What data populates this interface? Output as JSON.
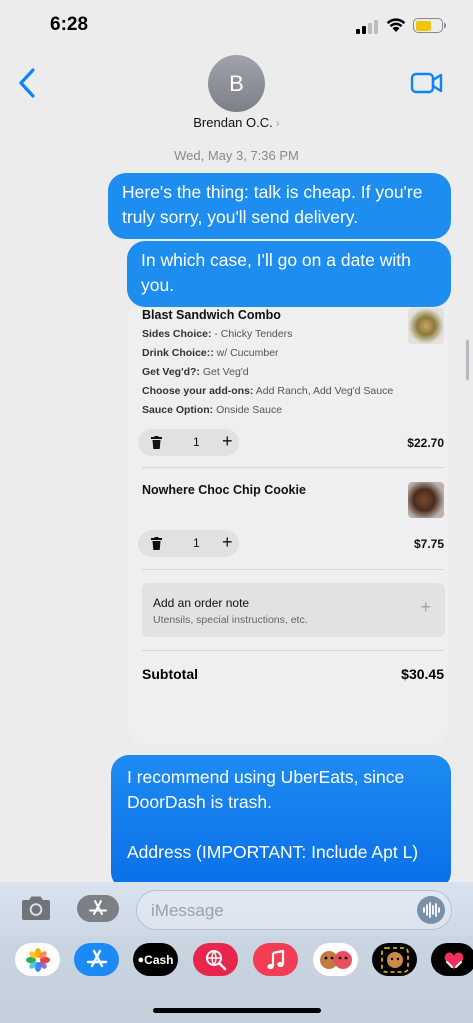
{
  "status_bar": {
    "time": "6:28"
  },
  "header": {
    "avatar_initial": "B",
    "contact_name": "Brendan O.C.",
    "contact_chevron": "›",
    "back_icon": "chevron-left-icon",
    "video_icon": "video-camera-icon",
    "accent_color": "#0a84ff"
  },
  "thread": {
    "timestamp": "Wed, May 3, 7:36 PM",
    "messages": [
      {
        "text": "Here's the thing: talk is cheap. If you're truly sorry, you'll send delivery."
      },
      {
        "text": "In which case, I'll go on a date with you."
      },
      {
        "text": "I recommend using UberEats, since DoorDash is trash.\n\nAddress (IMPORTANT: Include Apt L)"
      }
    ],
    "bubble_color": "#1e8df0"
  },
  "order": {
    "items": [
      {
        "name": "Blast Sandwich Combo",
        "options": [
          {
            "label": "Sides Choice:",
            "value": " - Chicky Tenders"
          },
          {
            "label": "Drink Choice::",
            "value": " w/ Cucumber"
          },
          {
            "label": "Get Veg'd?:",
            "value": " Get Veg'd"
          },
          {
            "label": "Choose your add-ons:",
            "value": " Add Ranch, Add Veg'd Sauce"
          },
          {
            "label": "Sauce Option:",
            "value": " Onside Sauce"
          }
        ],
        "quantity": "1",
        "price": "$22.70"
      },
      {
        "name": "Nowhere Choc Chip Cookie",
        "options": [],
        "quantity": "1",
        "price": "$7.75"
      }
    ],
    "note": {
      "title": "Add an order note",
      "subtitle": "Utensils, special instructions, etc.",
      "plus": "+"
    },
    "subtotal_label": "Subtotal",
    "subtotal_value": "$30.45"
  },
  "input_bar": {
    "placeholder": "iMessage",
    "camera_icon": "camera-icon",
    "apps_icon": "app-store-icon",
    "audio_icon": "waveform-icon"
  },
  "app_drawer": {
    "apps": [
      {
        "name": "photos-app-icon"
      },
      {
        "name": "app-store-app-icon"
      },
      {
        "name": "apple-cash-app-icon",
        "label": "Cash"
      },
      {
        "name": "web-search-app-icon"
      },
      {
        "name": "music-app-icon"
      },
      {
        "name": "memoji-app-icon"
      },
      {
        "name": "memoji-stickers-app-icon"
      },
      {
        "name": "digital-touch-app-icon"
      }
    ]
  }
}
